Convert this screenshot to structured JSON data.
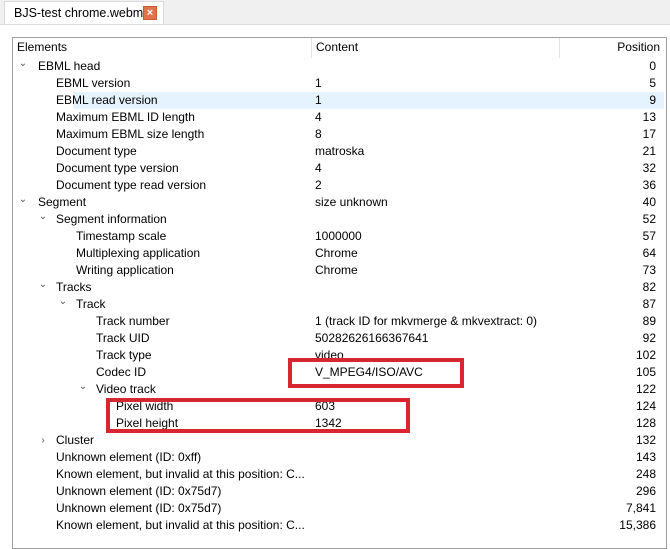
{
  "tab": {
    "title": "BJS-test chrome.webm",
    "close_icon": "close-icon"
  },
  "columns": {
    "elements": "Elements",
    "content": "Content",
    "position": "Position"
  },
  "colors": {
    "selection": "#e5f3ff",
    "highlight": "#d7262f",
    "tab_close": "#e0734c"
  },
  "rows": [
    {
      "level": 0,
      "expander": "expanded",
      "name": "EBML head",
      "content": "",
      "position": "0"
    },
    {
      "level": 1,
      "expander": "none",
      "name": "EBML version",
      "content": "1",
      "position": "5"
    },
    {
      "level": 1,
      "expander": "none",
      "name": "EBML read version",
      "content": "1",
      "position": "9",
      "selected": true
    },
    {
      "level": 1,
      "expander": "none",
      "name": "Maximum EBML ID length",
      "content": "4",
      "position": "13"
    },
    {
      "level": 1,
      "expander": "none",
      "name": "Maximum EBML size length",
      "content": "8",
      "position": "17"
    },
    {
      "level": 1,
      "expander": "none",
      "name": "Document type",
      "content": "matroska",
      "position": "21"
    },
    {
      "level": 1,
      "expander": "none",
      "name": "Document type version",
      "content": "4",
      "position": "32"
    },
    {
      "level": 1,
      "expander": "none",
      "name": "Document type read version",
      "content": "2",
      "position": "36"
    },
    {
      "level": 0,
      "expander": "expanded",
      "name": "Segment",
      "content": "size unknown",
      "position": "40"
    },
    {
      "level": 1,
      "expander": "expanded",
      "name": "Segment information",
      "content": "",
      "position": "52"
    },
    {
      "level": 2,
      "expander": "none",
      "name": "Timestamp scale",
      "content": "1000000",
      "position": "57"
    },
    {
      "level": 2,
      "expander": "none",
      "name": "Multiplexing application",
      "content": "Chrome",
      "position": "64"
    },
    {
      "level": 2,
      "expander": "none",
      "name": "Writing application",
      "content": "Chrome",
      "position": "73"
    },
    {
      "level": 1,
      "expander": "expanded",
      "name": "Tracks",
      "content": "",
      "position": "82"
    },
    {
      "level": 2,
      "expander": "expanded",
      "name": "Track",
      "content": "",
      "position": "87"
    },
    {
      "level": 3,
      "expander": "none",
      "name": "Track number",
      "content": "1 (track ID for mkvmerge & mkvextract: 0)",
      "position": "89"
    },
    {
      "level": 3,
      "expander": "none",
      "name": "Track UID",
      "content": "50282626166367641",
      "position": "92"
    },
    {
      "level": 3,
      "expander": "none",
      "name": "Track type",
      "content": "video",
      "position": "102"
    },
    {
      "level": 3,
      "expander": "none",
      "name": "Codec ID",
      "content": "V_MPEG4/ISO/AVC",
      "position": "105"
    },
    {
      "level": 3,
      "expander": "expanded",
      "name": "Video track",
      "content": "",
      "position": "122"
    },
    {
      "level": 4,
      "expander": "none",
      "name": "Pixel width",
      "content": "603",
      "position": "124"
    },
    {
      "level": 4,
      "expander": "none",
      "name": "Pixel height",
      "content": "1342",
      "position": "128"
    },
    {
      "level": 1,
      "expander": "collapsed",
      "name": "Cluster",
      "content": "",
      "position": "132"
    },
    {
      "level": 1,
      "expander": "none",
      "name": "Unknown element (ID: 0xff)",
      "content": "",
      "position": "143"
    },
    {
      "level": 1,
      "expander": "none",
      "name": "Known element, but invalid at this position: C...",
      "content": "",
      "position": "248"
    },
    {
      "level": 1,
      "expander": "none",
      "name": "Unknown element (ID: 0x75d7)",
      "content": "",
      "position": "296"
    },
    {
      "level": 1,
      "expander": "none",
      "name": "Unknown element (ID: 0x75d7)",
      "content": "",
      "position": "7,841"
    },
    {
      "level": 1,
      "expander": "none",
      "name": "Known element, but invalid at this position: C...",
      "content": "",
      "position": "15,386"
    }
  ]
}
